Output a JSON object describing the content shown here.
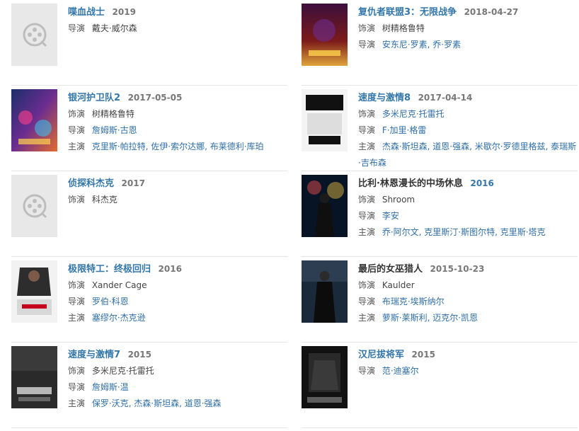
{
  "items_left": [
    {
      "title": "喋血战士",
      "date": "2019",
      "rows": [
        {
          "label": "导演",
          "value": "戴夫·威尔森"
        }
      ]
    },
    {
      "title": "银河护卫队2",
      "date": "2017-05-05",
      "rows": [
        {
          "label": "饰演",
          "value": "树精格鲁特"
        },
        {
          "label": "导演",
          "value": "詹姆斯·古恩"
        },
        {
          "label": "主演",
          "value": "克里斯·帕拉特, 佐伊·索尔达娜, 布莱德利·库珀"
        }
      ]
    },
    {
      "title": "侦探科杰克",
      "date": "2017",
      "rows": [
        {
          "label": "饰演",
          "value": "科杰克"
        }
      ]
    },
    {
      "title": "极限特工：终极回归",
      "date": "2016",
      "rows": [
        {
          "label": "饰演",
          "value": "Xander Cage"
        },
        {
          "label": "导演",
          "value": "罗伯·科恩"
        },
        {
          "label": "主演",
          "value": "塞缪尔·杰克逊"
        }
      ]
    },
    {
      "title": "速度与激情7",
      "date": "2015",
      "rows": [
        {
          "label": "饰演",
          "value": "多米尼克·托雷托"
        },
        {
          "label": "导演",
          "value": "詹姆斯·温"
        },
        {
          "label": "主演",
          "value": "保罗·沃克, 杰森·斯坦森, 道恩·强森"
        }
      ]
    }
  ],
  "items_right": [
    {
      "title": "复仇者联盟3：无限战争",
      "date": "2018-04-27",
      "rows": [
        {
          "label": "饰演",
          "value": "树精格鲁特"
        },
        {
          "label": "导演",
          "value": "安东尼·罗素, 乔·罗素"
        }
      ]
    },
    {
      "title": "速度与激情8",
      "date": "2017-04-14",
      "rows": [
        {
          "label": "饰演",
          "value": "多米尼克·托雷托"
        },
        {
          "label": "导演",
          "value": "F·加里·格雷"
        },
        {
          "label": "主演",
          "value": "杰森·斯坦森, 道恩·强森, 米歇尔·罗德里格兹, 泰瑞斯·吉布森"
        }
      ]
    },
    {
      "title": "比利·林恩漫长的中场休息",
      "date": "2016",
      "rows": [
        {
          "label": "饰演",
          "value": "Shroom"
        },
        {
          "label": "导演",
          "value": "李安"
        },
        {
          "label": "主演",
          "value": "乔·阿尔文, 克里斯汀·斯图尔特, 克里斯·塔克"
        }
      ]
    },
    {
      "title": "最后的女巫猎人",
      "date": "2015-10-23",
      "rows": [
        {
          "label": "饰演",
          "value": "Kaulder"
        },
        {
          "label": "导演",
          "value": "布瑞克·埃斯纳尔"
        },
        {
          "label": "主演",
          "value": "萝斯·莱斯利, 迈克尔·凯恩"
        }
      ]
    },
    {
      "title": "汉尼拔将军",
      "date": "2015",
      "rows": [
        {
          "label": "导演",
          "value": "范·迪塞尔"
        }
      ]
    }
  ]
}
